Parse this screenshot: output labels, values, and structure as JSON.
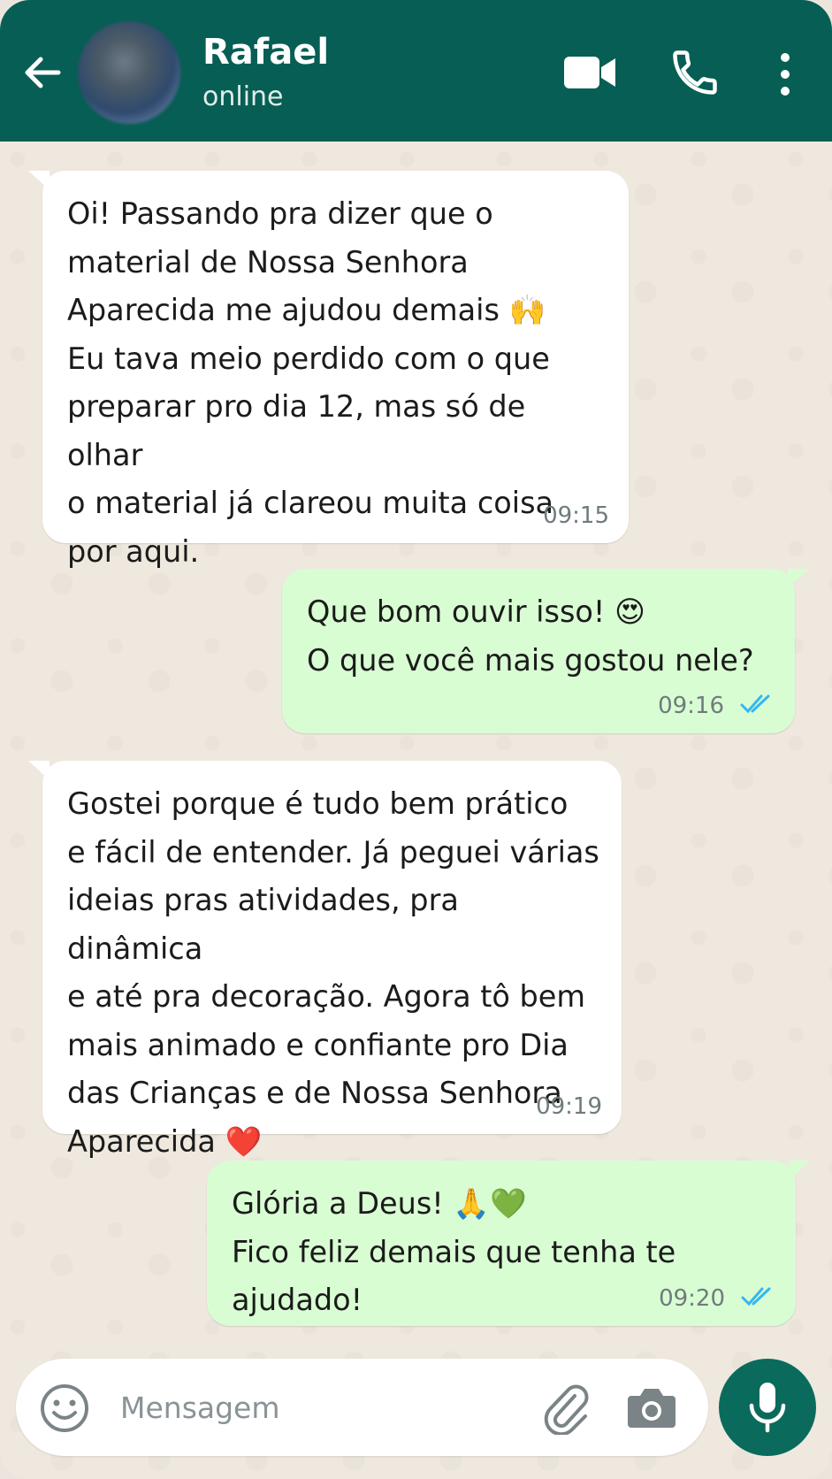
{
  "header": {
    "contact_name": "Rafael",
    "status": "online",
    "bg_color": "#075e54"
  },
  "messages": [
    {
      "direction": "incoming",
      "text": "Oi! Passando pra dizer que o\nmaterial de Nossa Senhora\nAparecida me ajudou demais 🙌\nEu tava meio perdido com o que\npreparar pro dia 12, mas só de olhar\no material já clareou muita coisa\npor aqui.",
      "time": "09:15"
    },
    {
      "direction": "outgoing",
      "text": "Que bom ouvir isso! 😍\nO que você mais gostou nele?",
      "time": "09:16",
      "read": true
    },
    {
      "direction": "incoming",
      "text": "Gostei porque é tudo bem prático\ne fácil de entender. Já peguei várias\nideias pras atividades, pra dinâmica\ne até pra decoração. Agora tô bem\nmais animado e confiante pro Dia\ndas Crianças e de Nossa Senhora\nAparecida ❤️",
      "time": "09:19"
    },
    {
      "direction": "outgoing",
      "text": "Glória a Deus! 🙏💚\nFico feliz demais que tenha te ajudado!",
      "time": "09:20",
      "read": true
    }
  ],
  "composer": {
    "placeholder": "Mensagem",
    "icons": [
      "smiley-icon",
      "paperclip-icon",
      "camera-icon",
      "microphone-icon"
    ]
  },
  "colors": {
    "incoming_bubble": "#ffffff",
    "outgoing_bubble": "#d9fdd3",
    "read_ticks": "#34b7f1",
    "mic_button": "#0a6b5c"
  }
}
